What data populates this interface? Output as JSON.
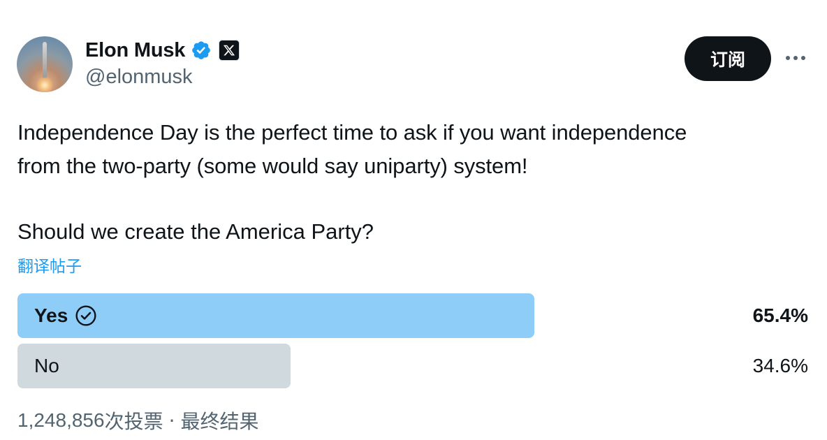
{
  "author": {
    "name": "Elon Musk",
    "handle": "@elonmusk"
  },
  "header": {
    "subscribe_label": "订阅"
  },
  "tweet": {
    "text_line1": "Independence Day is the perfect time to ask if you want independence",
    "text_line2": "from the two-party (some would say uniparty) system!",
    "question": "Should we create the America Party?",
    "translate_label": "翻译帖子"
  },
  "poll": {
    "options": [
      {
        "label": "Yes",
        "percent_label": "65.4%",
        "fraction": 0.654,
        "winner": true
      },
      {
        "label": "No",
        "percent_label": "34.6%",
        "fraction": 0.346,
        "winner": false
      }
    ],
    "votes_count": "1,248,856",
    "votes_suffix": " 次投票",
    "separator": "·",
    "status": "最终结果"
  },
  "colors": {
    "accent": "#1d9bf0",
    "winner_bar": "#8ecdf7",
    "loser_bar": "#cfd9de",
    "text": "#0f1419",
    "secondary_text": "#536471"
  },
  "icons": {
    "verified": "verified-badge-icon",
    "x_logo": "x-logo-icon",
    "more": "more-horizontal-icon",
    "check": "check-circle-icon"
  }
}
